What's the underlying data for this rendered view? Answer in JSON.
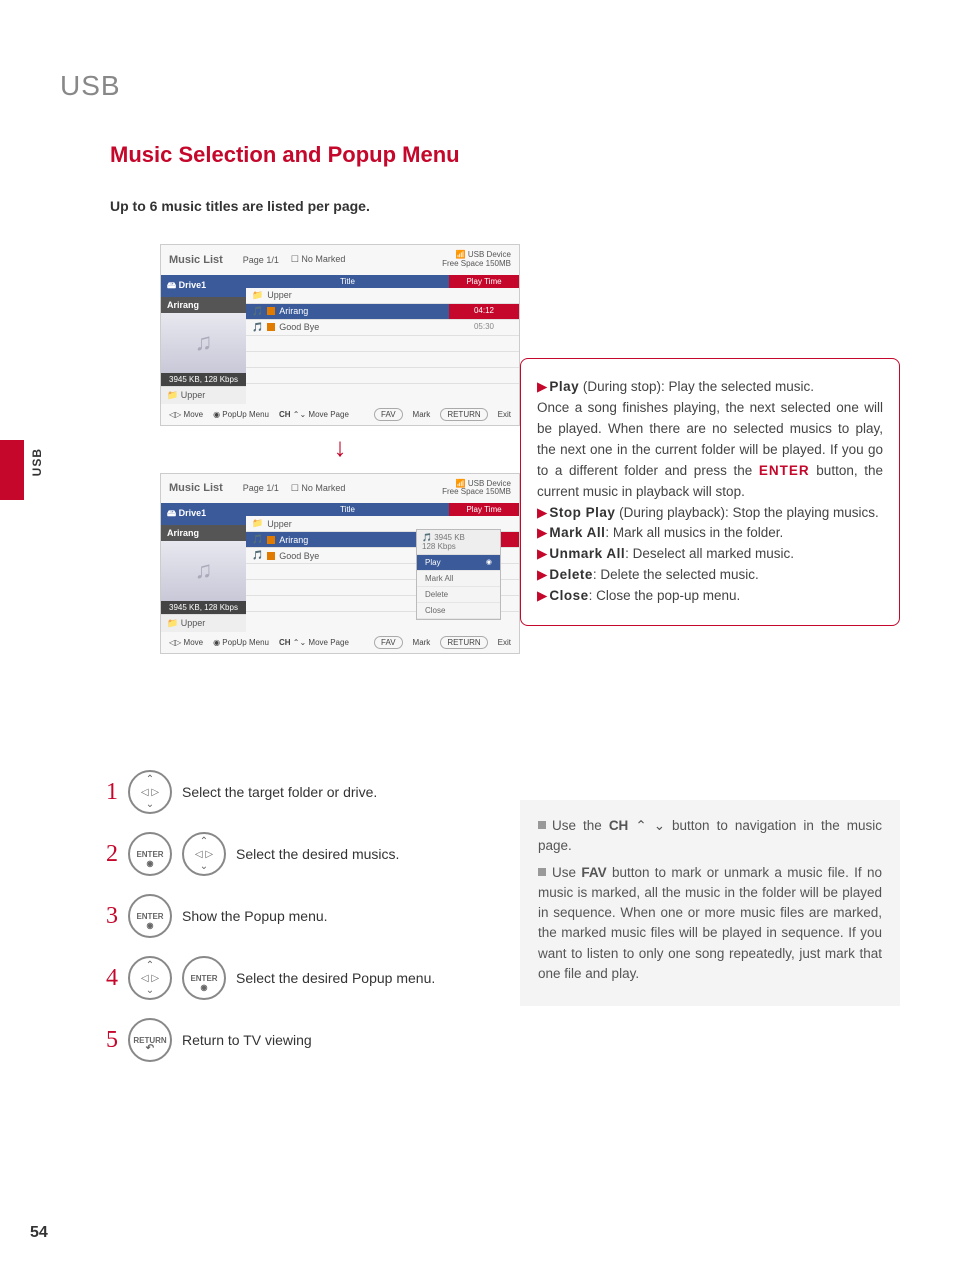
{
  "section_header": "USB",
  "page_title": "Music Selection and Popup Menu",
  "intro": "Up to 6 music titles are listed per page.",
  "side_label": "USB",
  "page_number": "54",
  "screen": {
    "title": "Music List",
    "page": "Page 1/1",
    "no_marked": "No Marked",
    "usb_device": "USB Device",
    "free_space": "Free Space 150MB",
    "drive": "Drive1",
    "folder": "Arirang",
    "info": "3945 KB, 128 Kbps",
    "upper": "Upper",
    "col_title": "Title",
    "col_play": "Play Time",
    "rows": [
      {
        "title": "Upper",
        "time": "",
        "type": "upper"
      },
      {
        "title": "Arirang",
        "time": "04:12",
        "type": "song",
        "marked": true,
        "selected": true
      },
      {
        "title": "Good Bye",
        "time": "05:30",
        "type": "song",
        "marked": true
      }
    ],
    "footer": {
      "move": "Move",
      "popup": "PopUp Menu",
      "ch": "CH",
      "move_page": "Move Page",
      "fav": "FAV",
      "mark": "Mark",
      "return": "RETURN",
      "exit": "Exit"
    }
  },
  "popup": {
    "info_size": "3945 KB",
    "info_rate": "128 Kbps",
    "items": [
      "Play",
      "Mark All",
      "Delete",
      "Close"
    ]
  },
  "descriptions": {
    "play_label": "Play",
    "play_cond": " (During stop): Play the selected music.",
    "play_body": "Once a song finishes playing, the next selected one will be played. When there are no selected musics to play, the next one in the current folder will be played. If you go to a different folder and press the ",
    "enter_word": "ENTER",
    "play_body2": " button, the current music in playback will stop.",
    "stop_label": "Stop Play",
    "stop_body": " (During playback): Stop the playing musics.",
    "mark_label": "Mark All",
    "mark_body": ": Mark all musics in the folder.",
    "unmark_label": "Unmark All",
    "unmark_body": ": Deselect all marked music.",
    "delete_label": "Delete",
    "delete_body": ": Delete the selected music.",
    "close_label": "Close",
    "close_body": ": Close the pop-up menu."
  },
  "steps": {
    "enter_label": "ENTER",
    "return_label": "RETURN",
    "s1": "Select the target folder or drive.",
    "s2": "Select the desired musics.",
    "s3": "Show the Popup menu.",
    "s4": "Select the desired Popup menu.",
    "s5": "Return to TV viewing"
  },
  "tips": {
    "t1a": "Use the ",
    "t1_ch": "CH",
    "t1b": " button to navigation in the music page.",
    "t2a": "Use ",
    "t2_fav": "FAV",
    "t2b": " button to mark or unmark a music file. If no music is marked, all the music in the folder will be played in sequence. When one or more music files are marked, the marked music files will be played in sequence. If you want to listen to only one song repeatedly, just mark that one file and play."
  }
}
